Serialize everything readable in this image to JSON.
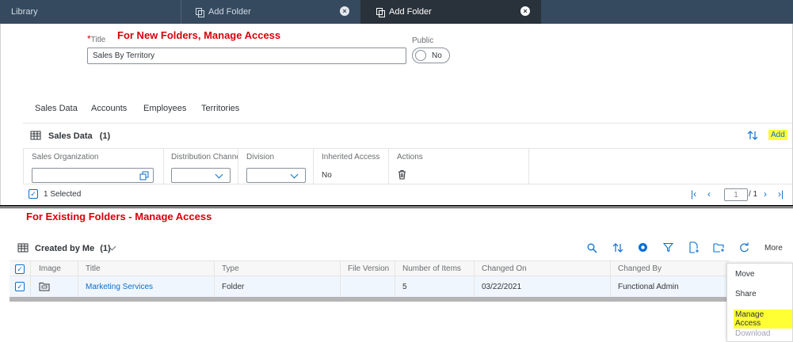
{
  "tabs": [
    {
      "label": "Library"
    },
    {
      "label": "Add Folder",
      "close": "×"
    },
    {
      "label": "Add Folder",
      "close": "×"
    }
  ],
  "annotations": {
    "new_folders": "For New Folders, Manage Access",
    "existing_folders": "For Existing Folders - Manage Access"
  },
  "form": {
    "title_required": "*",
    "title_label": "Title",
    "title_value": "Sales By Territory",
    "public_label": "Public",
    "public_value": "No"
  },
  "subtabs": [
    "Sales Data",
    "Accounts",
    "Employees",
    "Territories"
  ],
  "sales_table": {
    "title": "Sales Data",
    "count": "(1)",
    "add_label": "Add",
    "columns": [
      "Sales Organization",
      "Distribution Channe",
      "Division",
      "Inherited Access",
      "Actions"
    ],
    "row": {
      "inherited_access": "No"
    },
    "selected_text": "1 Selected",
    "page_current": "1",
    "page_total": "/ 1"
  },
  "files_table": {
    "title": "Created by Me",
    "count": "(1)",
    "more_label": "More",
    "columns": [
      "Image",
      "Title",
      "Type",
      "File Version",
      "Number of Items",
      "Changed On",
      "Changed By"
    ],
    "rows": [
      {
        "title": "Marketing Services",
        "type": "Folder",
        "file_version": "",
        "number_of_items": "5",
        "changed_on": "03/22/2021",
        "changed_by": "Functional Admin"
      }
    ]
  },
  "more_menu": {
    "items": [
      "Move",
      "Share",
      "Manage Access",
      "Download"
    ]
  },
  "colors": {
    "tabbar": "#354a5f",
    "active_tab": "#29313a",
    "accent": "#0a6ed1",
    "annotation_red": "#d8000c",
    "highlight": "#ffff33"
  },
  "icons": [
    "table-icon",
    "sort-icon",
    "copy-icon",
    "chevron-down-icon",
    "trash-icon",
    "search-icon",
    "settings-icon",
    "filter-icon",
    "new-file-icon",
    "new-folder-icon",
    "refresh-icon",
    "folder-icon"
  ]
}
